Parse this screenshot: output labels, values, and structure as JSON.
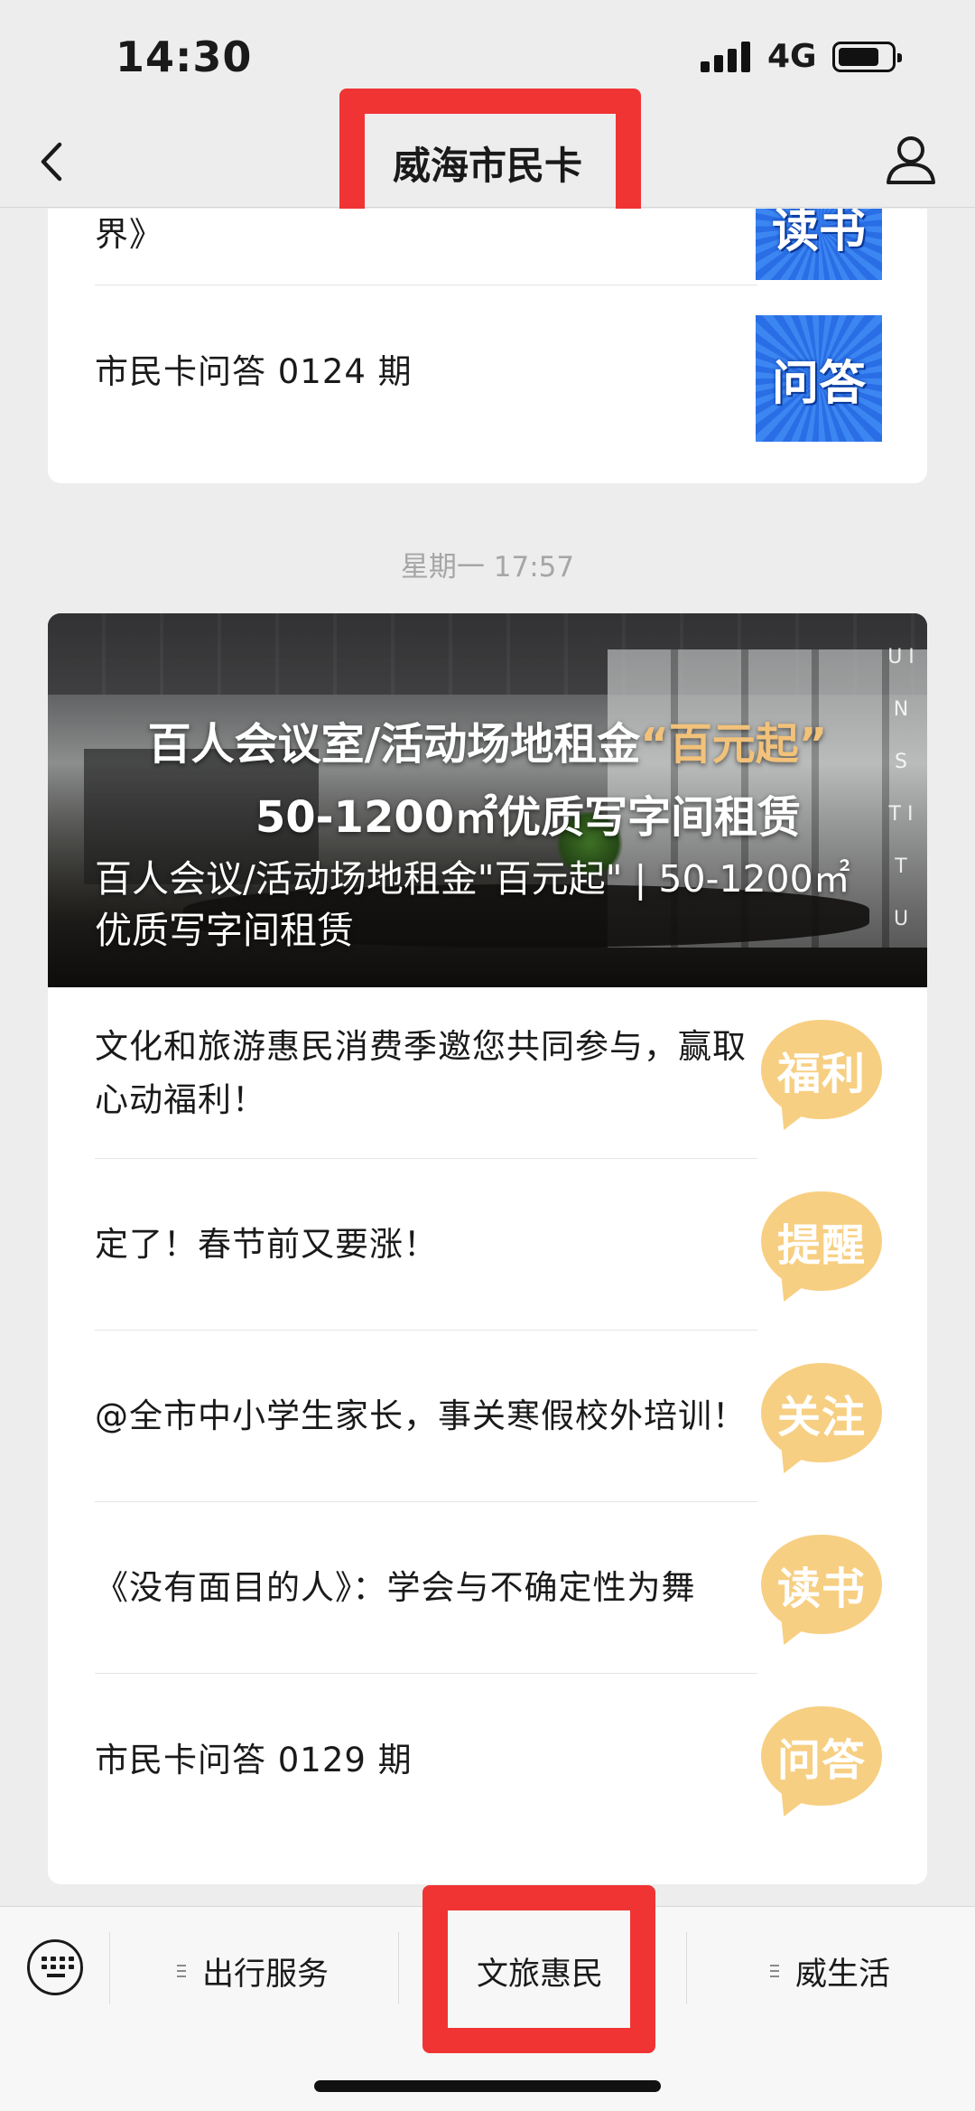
{
  "status_bar": {
    "time": "14:30",
    "network": "4G"
  },
  "nav": {
    "title": "威海市民卡"
  },
  "group1": {
    "articles": [
      {
        "title": "界》",
        "thumb_label": "读书"
      },
      {
        "title": "市民卡问答 0124 期",
        "thumb_label": "问答"
      }
    ]
  },
  "timestamp": "星期一 17:57",
  "group2": {
    "cover": {
      "headline_part1": "百人会议室/活动场地租金",
      "headline_highlight": "“百元起”",
      "headline_line2": "50-1200㎡优质写字间租赁",
      "side_text": "U I N S T I T U",
      "title": "百人会议/活动场地租金\"百元起\" | 50-1200㎡优质写字间租赁"
    },
    "articles": [
      {
        "title": "文化和旅游惠民消费季邀您共同参与，赢取心动福利！",
        "thumb_label": "福利"
      },
      {
        "title": "定了！春节前又要涨！",
        "thumb_label": "提醒"
      },
      {
        "title": "@全市中小学生家长，事关寒假校外培训！",
        "thumb_label": "关注"
      },
      {
        "title": "《没有面目的人》：学会与不确定性为舞",
        "thumb_label": "读书"
      },
      {
        "title": "市民卡问答 0129 期",
        "thumb_label": "问答"
      }
    ]
  },
  "tabbar": {
    "tabs": [
      {
        "label": "出行服务"
      },
      {
        "label": "文旅惠民"
      },
      {
        "label": "威生活"
      }
    ]
  },
  "colors": {
    "highlight_box": "#f03434",
    "bubble_orange": "#f7cf82",
    "thumb_blue": "#2a6ee6",
    "cover_accent": "#f2c27a",
    "background": "#ededed"
  },
  "icons": [
    "back-arrow-icon",
    "profile-icon",
    "keyboard-icon",
    "menu-lines-icon",
    "signal-icon",
    "battery-icon"
  ]
}
